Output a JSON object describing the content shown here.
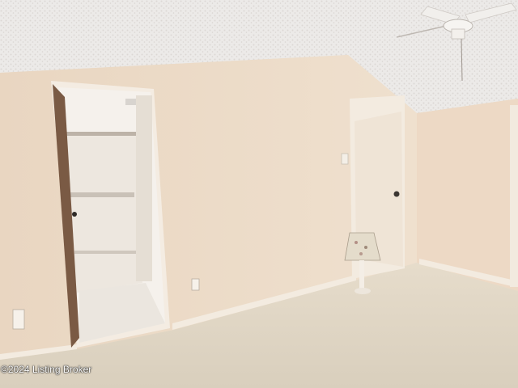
{
  "photo": {
    "watermark": "©2024 Listing Broker",
    "subject": "empty-bedroom-interior"
  },
  "colors": {
    "ceiling": "#ece9e6",
    "wall": "#ead8c4",
    "carpet": "#e2d7c3",
    "door": "#efe4d6",
    "trim": "#f1e8dc"
  }
}
